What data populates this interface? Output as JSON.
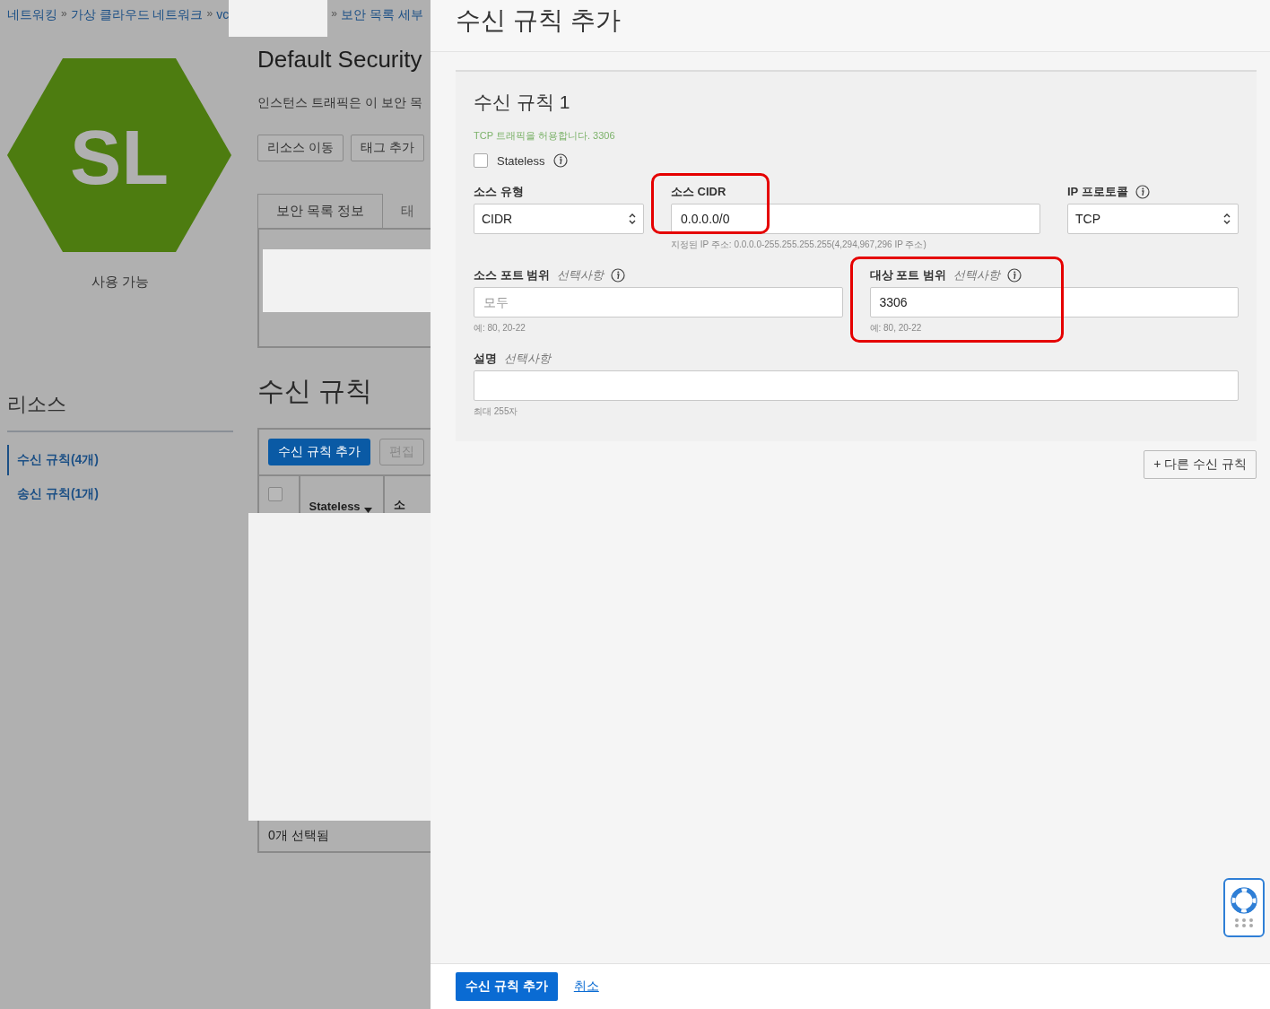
{
  "breadcrumb": [
    {
      "kind": "link",
      "label": "네트워킹"
    },
    {
      "kind": "separator",
      "label": "»"
    },
    {
      "kind": "link",
      "label": "가상 클라우드 네트워크"
    },
    {
      "kind": "separator",
      "label": "»"
    },
    {
      "kind": "link",
      "label": "vc"
    },
    {
      "kind": "redacted"
    },
    {
      "kind": "separator",
      "label": "»"
    },
    {
      "kind": "link",
      "label": "보안 목록 세부"
    }
  ],
  "resource": {
    "logo_text": "SL",
    "status": "사용 가능"
  },
  "sidebar": {
    "title": "리소스",
    "items": [
      {
        "label": "수신 규칙(4개)",
        "selected": true
      },
      {
        "label": "송신 규칙(1개)",
        "selected": false
      }
    ]
  },
  "page": {
    "title": "Default Security",
    "description": "인스턴스 트래픽은 이 보안 목",
    "buttons": [
      "리소스 이동",
      "태그 추가"
    ],
    "tabs": [
      {
        "label": "보안 목록 정보",
        "selected": true
      },
      {
        "label": "태",
        "selected": false
      }
    ],
    "section_title": "수신 규칙",
    "toolbar": [
      {
        "label": "수신 규칙 추가",
        "kind": "primary",
        "disabled": false
      },
      {
        "label": "편집",
        "kind": "secondary",
        "disabled": true
      }
    ],
    "table": {
      "all_checked": false,
      "columns": [
        {
          "label": "Stateless",
          "sortable": true
        },
        {
          "label": "소",
          "sortable": false
        }
      ]
    },
    "selection_count": "0개 선택됨"
  },
  "panel": {
    "title": "수신 규칙 추가",
    "rule": {
      "title": "수신 규칙 1",
      "summary": "TCP 트래픽을 허용합니다. 3306",
      "stateless": {
        "label": "Stateless",
        "checked": false
      },
      "rows": [
        [
          {
            "kind": "select",
            "label": "소스 유형",
            "value": "CIDR",
            "info": false,
            "highlighted": false
          },
          {
            "kind": "input",
            "label": "소스 CIDR",
            "value": "0.0.0.0/0",
            "hint": "지정된 IP 주소: 0.0.0.0-255.255.255.255(4,294,967,296 IP 주소)",
            "info": false,
            "highlighted": true
          },
          {
            "kind": "select",
            "label": "IP 프로토콜",
            "value": "TCP",
            "info": true,
            "highlighted": false
          }
        ],
        [
          {
            "kind": "input",
            "label": "소스 포트 범위",
            "optional": "선택사항",
            "placeholder": "모두",
            "hint": "예: 80, 20-22",
            "info": true,
            "highlighted": false
          },
          {
            "kind": "input",
            "label": "대상 포트 범위",
            "optional": "선택사항",
            "value": "3306",
            "hint": "예: 80, 20-22",
            "info": true,
            "highlighted": true
          }
        ],
        [
          {
            "kind": "input",
            "label": "설명",
            "optional": "선택사항",
            "hint": "최대 255자",
            "info": false,
            "highlighted": false
          }
        ]
      ]
    },
    "add_another": "+ 다른 수신 규칙",
    "submit": "수신 규칙 추가",
    "cancel": "취소"
  }
}
